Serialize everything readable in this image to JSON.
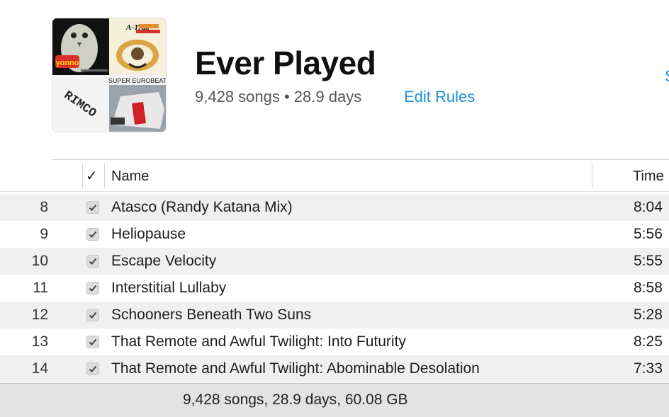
{
  "playlist": {
    "title": "Ever Played",
    "summary": "9,428 songs • 28.9 days",
    "edit_rules_label": "Edit Rules",
    "edge_link_fragment": "S",
    "artwork": [
      {
        "name": "owl-album-art",
        "text": "yonno"
      },
      {
        "name": "a-trak-album-art",
        "text": "A-Trak"
      },
      {
        "name": "rimco-album-art",
        "text": "RIMCO"
      },
      {
        "name": "super-eurobeat-album-art",
        "text": "SUPER EUROBEAT"
      }
    ]
  },
  "table": {
    "columns": {
      "check": "✓",
      "name": "Name",
      "time": "Time"
    },
    "rows": [
      {
        "num": "8",
        "checked": true,
        "name": "Atasco (Randy Katana Mix)",
        "time": "8:04"
      },
      {
        "num": "9",
        "checked": true,
        "name": "Heliopause",
        "time": "5:56"
      },
      {
        "num": "10",
        "checked": true,
        "name": "Escape Velocity",
        "time": "5:55"
      },
      {
        "num": "11",
        "checked": true,
        "name": "Interstitial Lullaby",
        "time": "8:58"
      },
      {
        "num": "12",
        "checked": true,
        "name": "Schooners Beneath Two Suns",
        "time": "5:28"
      },
      {
        "num": "13",
        "checked": true,
        "name": "That Remote and Awful Twilight: Into Futurity",
        "time": "8:25"
      },
      {
        "num": "14",
        "checked": true,
        "name": "That Remote and Awful Twilight: Abominable Desolation",
        "time": "7:33"
      }
    ]
  },
  "footer": {
    "status": "9,428 songs, 28.9 days, 60.08 GB"
  },
  "colors": {
    "accent": "#1e90d6",
    "row_alt": "#f0f0f0",
    "footer_bg": "#e3e3e3"
  }
}
